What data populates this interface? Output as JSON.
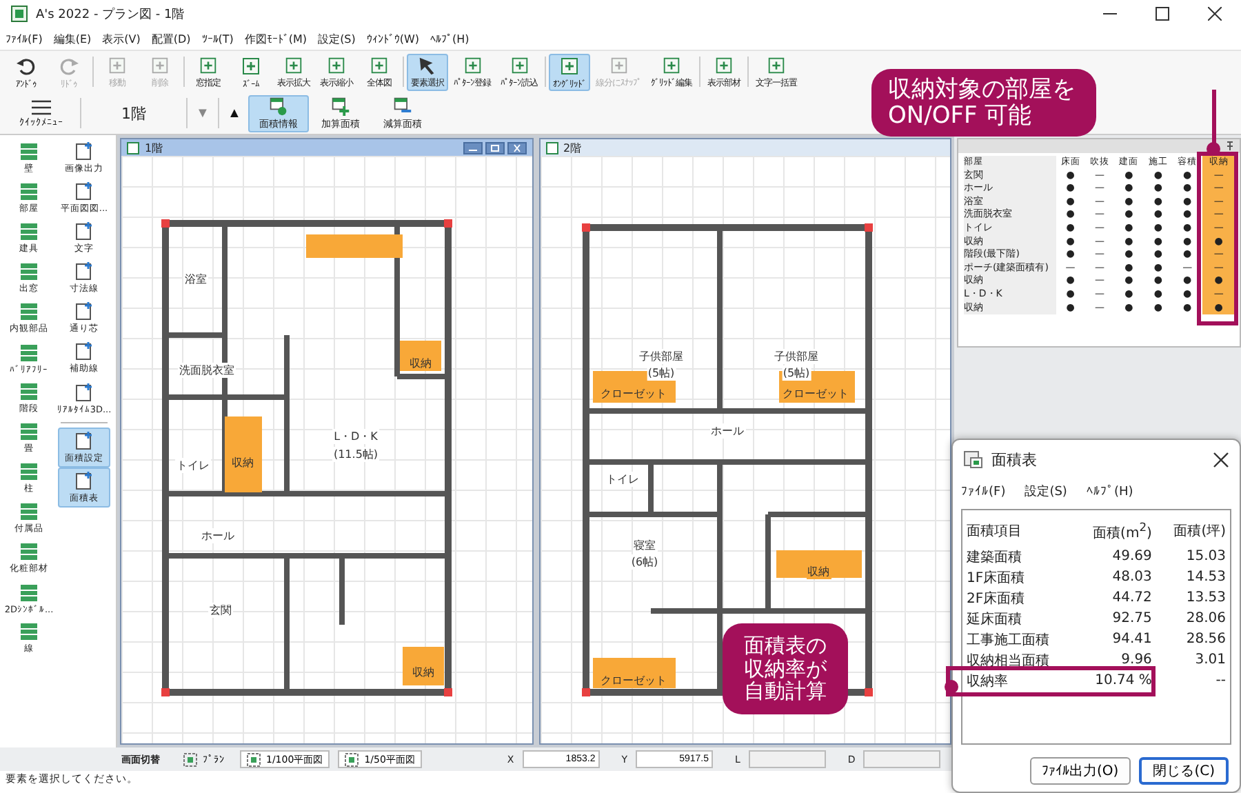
{
  "window": {
    "title": "A's 2022 - プラン図 - 1階"
  },
  "menu": [
    "ﾌｧｲﾙ(F)",
    "編集(E)",
    "表示(V)",
    "配置(D)",
    "ﾂｰﾙ(T)",
    "作図ﾓｰﾄﾞ(M)",
    "設定(S)",
    "ｳｨﾝﾄﾞｳ(W)",
    "ﾍﾙﾌﾟ(H)"
  ],
  "toolbar": {
    "row1": [
      {
        "label": "ｱﾝﾄﾞｩ",
        "selected": false,
        "disabled": false
      },
      {
        "label": "ﾘﾄﾞｩ",
        "selected": false,
        "disabled": true
      },
      {
        "label": "移動",
        "selected": false,
        "disabled": true
      },
      {
        "label": "削除",
        "selected": false,
        "disabled": true
      },
      {
        "label": "窓指定",
        "selected": false,
        "disabled": false
      },
      {
        "label": "ｽﾞｰﾑ",
        "selected": false,
        "disabled": false
      },
      {
        "label": "表示拡大",
        "selected": false,
        "disabled": false
      },
      {
        "label": "表示縮小",
        "selected": false,
        "disabled": false
      },
      {
        "label": "全体図",
        "selected": false,
        "disabled": false
      },
      {
        "label": "要素選択",
        "selected": true,
        "disabled": false
      },
      {
        "label": "ﾊﾟﾀｰﾝ登録",
        "selected": false,
        "disabled": false
      },
      {
        "label": "ﾊﾟﾀｰﾝ読込",
        "selected": false,
        "disabled": false
      },
      {
        "label": "ｵﾝｸﾞﾘｯﾄﾞ",
        "selected": true,
        "disabled": false
      },
      {
        "label": "線分にｽﾅｯﾌﾟ",
        "selected": false,
        "disabled": true
      },
      {
        "label": "ｸﾞﾘｯﾄﾞ編集",
        "selected": false,
        "disabled": false
      },
      {
        "label": "表示部材",
        "selected": false,
        "disabled": false
      },
      {
        "label": "文字一括置",
        "selected": false,
        "disabled": false
      }
    ],
    "quick_menu": "ｸｲｯｸﾒﾆｭｰ",
    "floor": "1階",
    "down": "▼",
    "up": "▲",
    "row2": [
      {
        "label": "面積情報",
        "selected": true
      },
      {
        "label": "加算面積",
        "selected": false
      },
      {
        "label": "減算面積",
        "selected": false
      }
    ]
  },
  "palette": {
    "left": [
      {
        "label": "壁",
        "selected": false
      },
      {
        "label": "部屋",
        "selected": false
      },
      {
        "label": "建具",
        "selected": false
      },
      {
        "label": "出窓",
        "selected": false
      },
      {
        "label": "内観部品",
        "selected": false
      },
      {
        "label": "ﾊﾞﾘｱﾌﾘｰ",
        "selected": false
      },
      {
        "label": "階段",
        "selected": false
      },
      {
        "label": "畳",
        "selected": false
      },
      {
        "label": "柱",
        "selected": false
      },
      {
        "label": "付属品",
        "selected": false
      },
      {
        "label": "化粧部材",
        "selected": false
      },
      {
        "label": "2Dｼﾝﾎﾞﾙ...",
        "selected": false
      },
      {
        "label": "線",
        "selected": false
      }
    ],
    "right": [
      {
        "label": "画像出力",
        "selected": false
      },
      {
        "label": "平面図図...",
        "selected": false
      },
      {
        "label": "文字",
        "selected": false
      },
      {
        "label": "寸法線",
        "selected": false
      },
      {
        "label": "通り芯",
        "selected": false
      },
      {
        "label": "補助線",
        "selected": false
      },
      {
        "label": "ﾘｱﾙﾀｲﾑ3D...",
        "selected": false
      },
      {
        "label": "面積設定",
        "selected": true
      },
      {
        "label": "面積表",
        "selected": true
      }
    ]
  },
  "plans": [
    {
      "title": "1階",
      "labels": [
        "浴室",
        "洗面脱衣室",
        "収納",
        "トイレ",
        "L・D・K",
        "(11.5帖)",
        "収納",
        "ホール",
        "玄関",
        "収納"
      ]
    },
    {
      "title": "2階",
      "labels": [
        "子供部屋",
        "(5帖)",
        "子供部屋",
        "(5帖)",
        "クローゼット",
        "クローゼット",
        "ホール",
        "トイレ",
        "寝室",
        "(6帖)",
        "収納",
        "クローゼット"
      ]
    }
  ],
  "room_table": {
    "header": "部屋",
    "columns": [
      {
        "label": "床面",
        "highlighted": false
      },
      {
        "label": "吹抜",
        "highlighted": false
      },
      {
        "label": "建面",
        "highlighted": false
      },
      {
        "label": "施工",
        "highlighted": false
      },
      {
        "label": "容積",
        "highlighted": false
      },
      {
        "label": "収納",
        "highlighted": true
      }
    ],
    "rows": [
      {
        "room": "玄関",
        "cells": [
          "●",
          "—",
          "●",
          "●",
          "●",
          "—"
        ]
      },
      {
        "room": "ホール",
        "cells": [
          "●",
          "—",
          "●",
          "●",
          "●",
          "—"
        ]
      },
      {
        "room": "浴室",
        "cells": [
          "●",
          "—",
          "●",
          "●",
          "●",
          "—"
        ]
      },
      {
        "room": "洗面脱衣室",
        "cells": [
          "●",
          "—",
          "●",
          "●",
          "●",
          "—"
        ]
      },
      {
        "room": "トイレ",
        "cells": [
          "●",
          "—",
          "●",
          "●",
          "●",
          "—"
        ]
      },
      {
        "room": "収納",
        "cells": [
          "●",
          "—",
          "●",
          "●",
          "●",
          "●"
        ]
      },
      {
        "room": "階段(最下階)",
        "cells": [
          "●",
          "—",
          "●",
          "●",
          "●",
          "—"
        ]
      },
      {
        "room": "ポーチ(建築面積有)",
        "cells": [
          "—",
          "—",
          "●",
          "●",
          "—",
          "—"
        ]
      },
      {
        "room": "収納",
        "cells": [
          "●",
          "—",
          "●",
          "●",
          "●",
          "●"
        ]
      },
      {
        "room": "L・D・K",
        "cells": [
          "●",
          "—",
          "●",
          "●",
          "●",
          "—"
        ]
      },
      {
        "room": "収納",
        "cells": [
          "●",
          "—",
          "●",
          "●",
          "●",
          "●"
        ]
      }
    ]
  },
  "area_dialog": {
    "title": "面積表",
    "menu": [
      "ﾌｧｲﾙ(F)",
      "設定(S)",
      "ﾍﾙﾌﾟ(H)"
    ],
    "columns": [
      "面積項目",
      "面積(m$^{2}$)",
      "面積(坪)"
    ],
    "rows": [
      {
        "item": "建築面積",
        "sqm": "49.69",
        "tsubo": "15.03",
        "highlighted": false
      },
      {
        "item": "1F床面積",
        "sqm": "48.03",
        "tsubo": "14.53",
        "highlighted": false
      },
      {
        "item": "2F床面積",
        "sqm": "44.72",
        "tsubo": "13.53",
        "highlighted": false
      },
      {
        "item": "延床面積",
        "sqm": "92.75",
        "tsubo": "28.06",
        "highlighted": false
      },
      {
        "item": "工事施工面積",
        "sqm": "94.41",
        "tsubo": "28.56",
        "highlighted": false
      },
      {
        "item": "収納相当面積",
        "sqm": "9.96",
        "tsubo": "3.01",
        "highlighted": false
      },
      {
        "item": "収納率",
        "sqm": "10.74 %",
        "tsubo": "--",
        "highlighted": true
      }
    ],
    "buttons": [
      "ﾌｧｲﾙ出力(O)",
      "閉じる(C)"
    ]
  },
  "status_bar": {
    "switch_label": "画面切替",
    "views": [
      "ﾌﾟﾗﾝ",
      "1/100平面図",
      "1/50平面図"
    ],
    "fields": [
      {
        "label": "X",
        "value": "1853.2"
      },
      {
        "label": "Y",
        "value": "5917.5"
      },
      {
        "label": "L"
      },
      {
        "label": "D"
      }
    ],
    "message": "要素を選択してください。"
  },
  "callouts": [
    "収納対象の部屋をON/OFF 可能",
    "面積表の収納率が自動計算"
  ]
}
